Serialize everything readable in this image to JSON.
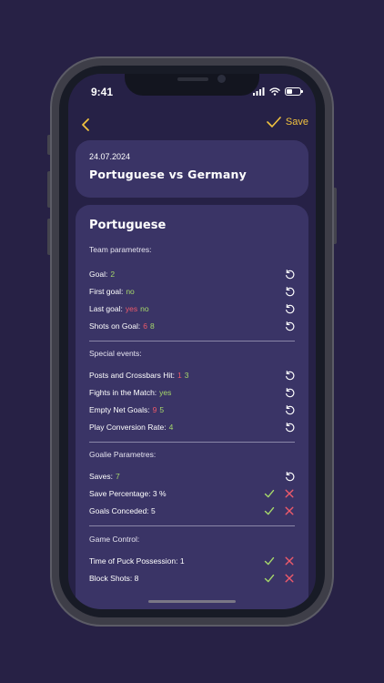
{
  "status_bar": {
    "time": "9:41"
  },
  "nav": {
    "save_label": "Save"
  },
  "header": {
    "date": "24.07.2024",
    "title": "Portuguese vs Germany"
  },
  "team": {
    "name": "Portuguese",
    "sections": [
      {
        "label": "Team parametres:",
        "rows": [
          {
            "label": "Goal:",
            "values": [
              {
                "text": "2",
                "color": "green"
              }
            ],
            "actions": [
              "reset"
            ]
          },
          {
            "label": "First goal:",
            "values": [
              {
                "text": "no",
                "color": "green"
              }
            ],
            "actions": [
              "reset"
            ]
          },
          {
            "label": "Last goal:",
            "values": [
              {
                "text": "yes",
                "color": "red"
              },
              {
                "text": "no",
                "color": "green"
              }
            ],
            "actions": [
              "reset"
            ]
          },
          {
            "label": "Shots on Goal:",
            "values": [
              {
                "text": "6",
                "color": "red"
              },
              {
                "text": "8",
                "color": "green"
              }
            ],
            "actions": [
              "reset"
            ]
          }
        ]
      },
      {
        "label": "Special events:",
        "rows": [
          {
            "label": "Posts and Crossbars Hit:",
            "values": [
              {
                "text": "1",
                "color": "red"
              },
              {
                "text": "3",
                "color": "green"
              }
            ],
            "actions": [
              "reset"
            ]
          },
          {
            "label": "Fights in the Match:",
            "values": [
              {
                "text": "yes",
                "color": "green"
              }
            ],
            "actions": [
              "reset"
            ]
          },
          {
            "label": "Empty Net Goals:",
            "values": [
              {
                "text": "9",
                "color": "red"
              },
              {
                "text": "5",
                "color": "green"
              }
            ],
            "actions": [
              "reset"
            ]
          },
          {
            "label": "Play Conversion Rate:",
            "values": [
              {
                "text": "4",
                "color": "green"
              }
            ],
            "actions": [
              "reset"
            ]
          }
        ]
      },
      {
        "label": "Goalie Parametres:",
        "rows": [
          {
            "label": "Saves:",
            "values": [
              {
                "text": "7",
                "color": "green"
              }
            ],
            "actions": [
              "reset"
            ]
          },
          {
            "label": "Save Percentage: 3 %",
            "values": [],
            "actions": [
              "confirm",
              "cancel"
            ]
          },
          {
            "label": "Goals Conceded: 5",
            "values": [],
            "actions": [
              "confirm",
              "cancel"
            ]
          }
        ]
      },
      {
        "label": "Game Control:",
        "rows": [
          {
            "label": "Time of Puck Possession: 1",
            "values": [],
            "actions": [
              "confirm",
              "cancel"
            ]
          },
          {
            "label": "Block Shots: 8",
            "values": [],
            "actions": [
              "confirm",
              "cancel"
            ]
          }
        ]
      }
    ]
  },
  "colors": {
    "background": "#272145",
    "card": "#3a3466",
    "accent": "#f1c23f",
    "positive": "#a6d86a",
    "negative": "#ee5a6a"
  },
  "icons": {
    "back": "chevron-left-icon",
    "save": "checkmark-icon",
    "reset": "reset-icon",
    "confirm": "checkmark-icon",
    "cancel": "close-icon"
  }
}
